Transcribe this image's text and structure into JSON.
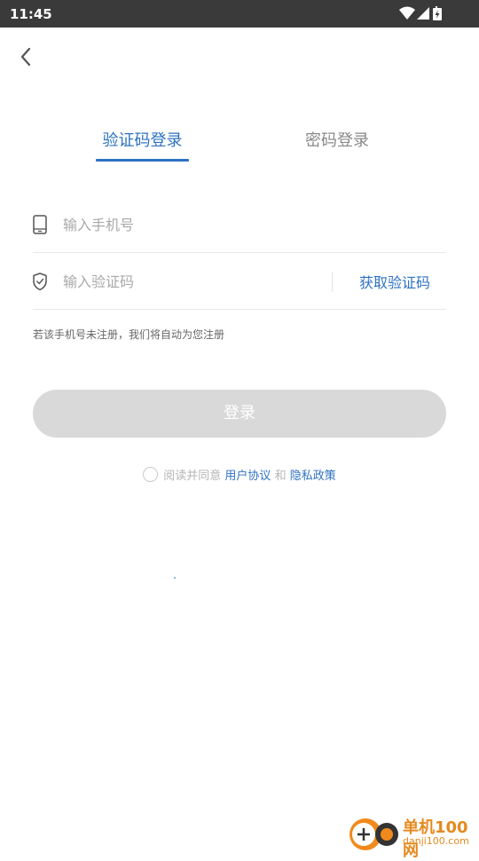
{
  "status_bar": {
    "time": "11:45",
    "icons": [
      "wifi-icon",
      "cell-signal-icon",
      "battery-charging-icon"
    ]
  },
  "nav": {
    "back_icon": "chevron-left-icon"
  },
  "tabs": [
    {
      "label": "验证码登录",
      "active": true
    },
    {
      "label": "密码登录",
      "active": false
    }
  ],
  "form": {
    "phone": {
      "icon": "phone-icon",
      "placeholder": "输入手机号",
      "value": ""
    },
    "code": {
      "icon": "shield-check-icon",
      "placeholder": "输入验证码",
      "value": "",
      "get_code_label": "获取验证码"
    },
    "hint": "若该手机号未注册，我们将自动为您注册"
  },
  "login_button": {
    "label": "登录",
    "enabled": false
  },
  "agreement": {
    "checked": false,
    "prefix": "阅读并同意",
    "user_agreement": "用户协议",
    "and": "和",
    "privacy_policy": "隐私政策"
  },
  "watermark": {
    "name": "单机100网",
    "url": "danji100.com"
  },
  "colors": {
    "accent": "#2e72c2",
    "status_bar": "#3a3a3a",
    "button_disabled": "#d9d9d9",
    "watermark": "#e58a1f"
  }
}
